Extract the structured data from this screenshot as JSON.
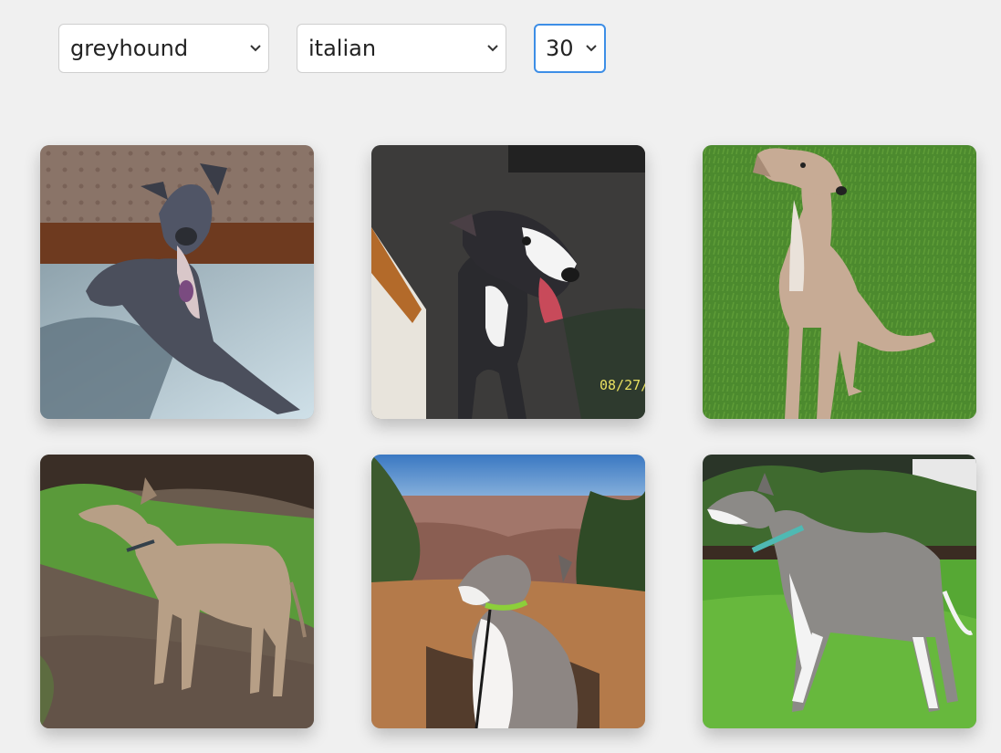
{
  "filters": {
    "breed": {
      "value": "greyhound",
      "icon": "chevron-down-icon"
    },
    "sub_breed": {
      "value": "italian",
      "icon": "chevron-down-icon"
    },
    "count": {
      "value": "30",
      "icon": "chevron-down-icon"
    }
  },
  "photos": [
    {
      "subject": "grey italian greyhound lying on carpet"
    },
    {
      "subject": "dark italian greyhound barking",
      "stamp": "08/27/2"
    },
    {
      "subject": "fawn italian greyhound sitting on grass"
    },
    {
      "subject": "fawn italian greyhound standing on dirt path"
    },
    {
      "subject": "grey and white italian greyhound sitting at canyon overlook"
    },
    {
      "subject": "grey and white italian greyhound standing on lawn"
    }
  ],
  "colors": {
    "background": "#f0f0f0",
    "focus_ring": "#3d8ee6"
  }
}
